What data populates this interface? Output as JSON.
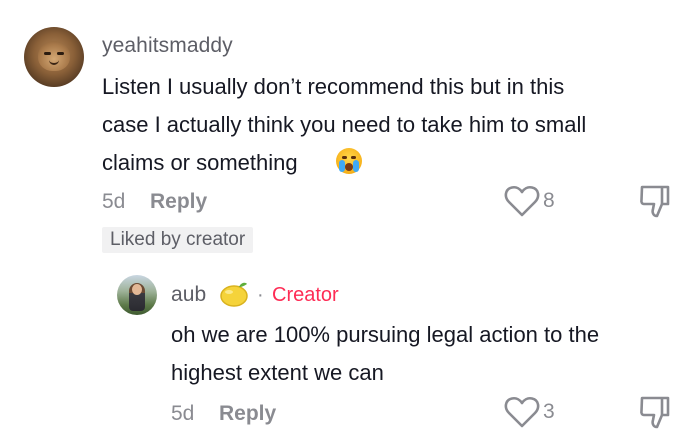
{
  "comment": {
    "username": "yeahitsmaddy",
    "lines": [
      "Listen I usually don’t recommend this but in this",
      "case I actually think you need to take him to small",
      "claims or something"
    ],
    "emoji": "loudly-crying-face",
    "age": "5d",
    "reply_label": "Reply",
    "likes": "8",
    "liked_by_creator": "Liked by creator"
  },
  "reply": {
    "username": "aub",
    "name_emoji": "lemon",
    "separator": "·",
    "creator_label": "Creator",
    "lines": [
      "oh we are 100% pursuing legal action to the",
      "highest extent we can"
    ],
    "age": "5d",
    "reply_label": "Reply",
    "likes": "3"
  },
  "colors": {
    "creator_accent": "#fe2c55",
    "muted": "#8a8b91",
    "text": "#161823"
  }
}
